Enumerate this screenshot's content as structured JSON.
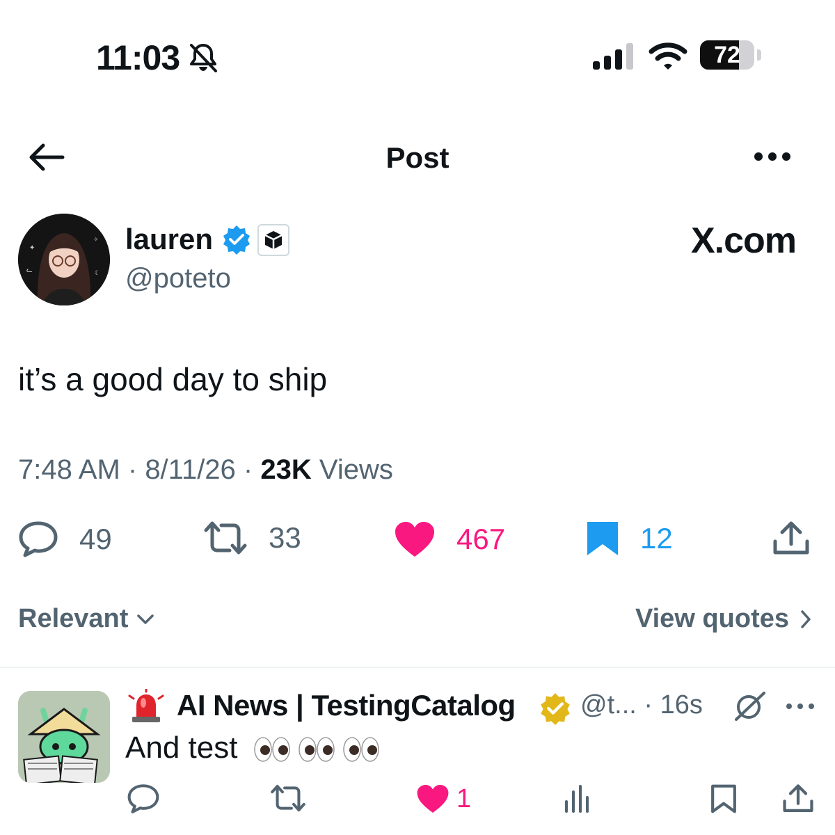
{
  "status_bar": {
    "time": "11:03",
    "battery": "72",
    "battery_level": 0.72
  },
  "header": {
    "title": "Post"
  },
  "post": {
    "author_name": "lauren",
    "author_handle": "@poteto",
    "affiliate_label": "X.com",
    "text": "it’s a good day to ship",
    "time": "7:48 AM",
    "date": "8/11/26",
    "views_count": "23K",
    "views_label": "Views",
    "stats": {
      "replies": "49",
      "reposts": "33",
      "likes": "467",
      "bookmarks": "12"
    },
    "colors": {
      "like": "#f91880",
      "bookmark": "#1d9bf0",
      "verified": "#1d9bf0"
    }
  },
  "sort": {
    "label": "Relevant",
    "quotes_label": "View quotes"
  },
  "reply": {
    "name": "AI News | TestingCatalog",
    "handle": "@t...",
    "time": "16s",
    "text": "And test",
    "likes": "1",
    "badge_color": "#e2b719"
  }
}
